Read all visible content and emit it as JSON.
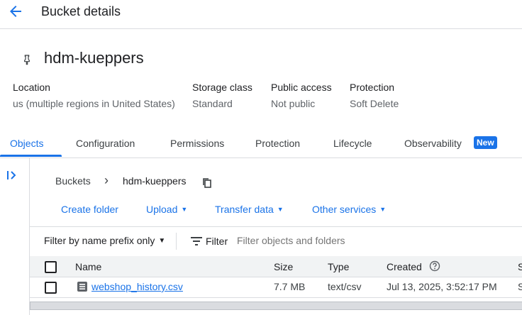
{
  "header": {
    "title": "Bucket details"
  },
  "bucket": {
    "name": "hdm-kueppers"
  },
  "meta": {
    "location_label": "Location",
    "location_value": "us (multiple regions in United States)",
    "storage_label": "Storage class",
    "storage_value": "Standard",
    "public_label": "Public access",
    "public_value": "Not public",
    "protection_label": "Protection",
    "protection_value": "Soft Delete"
  },
  "tabs": [
    {
      "label": "Objects"
    },
    {
      "label": "Configuration"
    },
    {
      "label": "Permissions"
    },
    {
      "label": "Protection"
    },
    {
      "label": "Lifecycle"
    },
    {
      "label": "Observability"
    }
  ],
  "tab_badge": "New",
  "breadcrumb": {
    "root": "Buckets",
    "separator": "›",
    "current": "hdm-kueppers"
  },
  "actions": {
    "create_folder": "Create folder",
    "upload": "Upload",
    "transfer": "Transfer data",
    "other": "Other services"
  },
  "filter": {
    "mode": "Filter by name prefix only",
    "filter_label": "Filter",
    "placeholder": "Filter objects and folders"
  },
  "table": {
    "columns": {
      "name": "Name",
      "size": "Size",
      "type": "Type",
      "created": "Created",
      "next": "S"
    },
    "rows": [
      {
        "name": "webshop_history.csv",
        "size": "7.7 MB",
        "type": "text/csv",
        "created": "Jul 13, 2025, 3:52:17 PM",
        "next": "S"
      }
    ]
  },
  "colors": {
    "accent": "#1a73e8",
    "text": "#202124",
    "muted": "#5f6368",
    "divider": "#dadce0"
  },
  "icons": [
    "back-arrow-icon",
    "pin-icon",
    "expand-panel-icon",
    "copy-icon",
    "filter-icon",
    "help-icon",
    "file-icon",
    "dropdown-icon"
  ]
}
